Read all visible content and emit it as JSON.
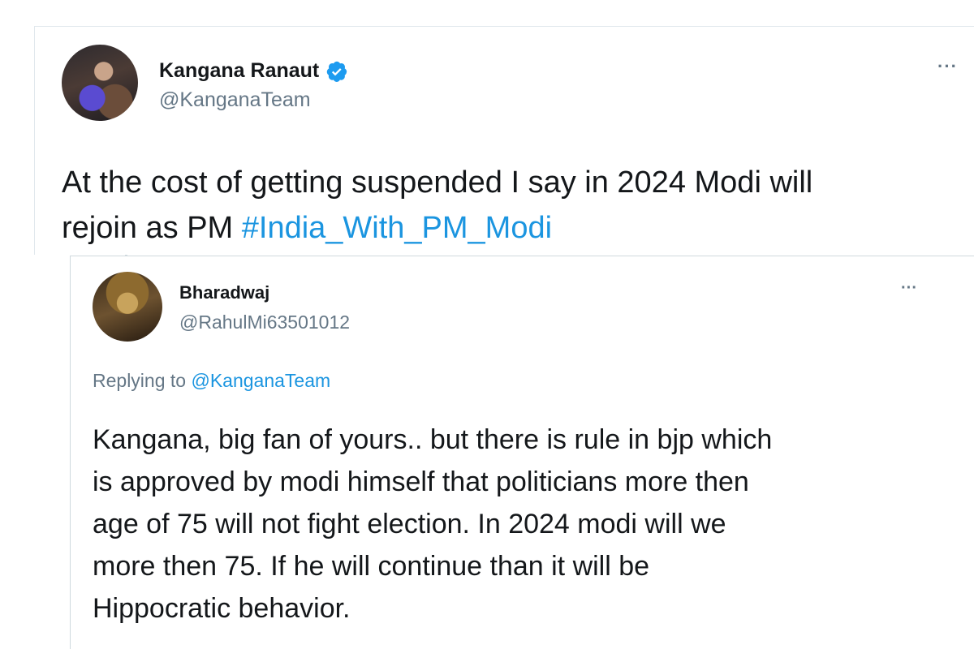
{
  "original_tweet": {
    "display_name": "Kangana Ranaut",
    "handle": "@KanganaTeam",
    "more_label": "···",
    "text_line1": "At the cost of getting suspended I say in 2024 Modi will",
    "text_line2_prefix": "rejoin as PM ",
    "hashtag": "#India_With_PM_Modi",
    "verified": true,
    "accent_color": "#1b95e0"
  },
  "reply_tweet": {
    "display_name": "Bharadwaj",
    "handle": "@RahulMi63501012",
    "more_label": "···",
    "replying_prefix": "Replying to ",
    "replying_mention": "@KanganaTeam",
    "text_lines": [
      "Kangana, big fan of yours.. but there is rule in bjp which",
      "is approved by modi himself that politicians more then",
      "age of 75 will not fight election. In 2024 modi will we",
      "more then 75. If he will continue than it will be",
      "Hippocratic behavior."
    ]
  }
}
